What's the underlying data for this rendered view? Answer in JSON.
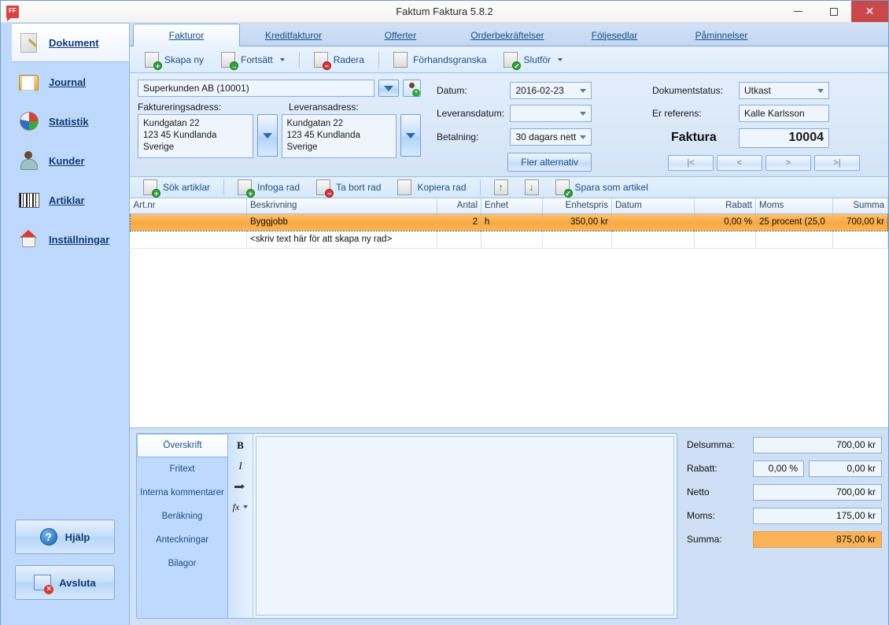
{
  "window": {
    "title": "Faktum Faktura 5.8.2",
    "app_icon": "FF",
    "minimize_label": "Minimera",
    "maximize_label": "Maximera",
    "close_label": "Stäng"
  },
  "sidebar": {
    "items": [
      {
        "label": "Dokument",
        "icon": "document-icon",
        "selected": true
      },
      {
        "label": "Journal",
        "icon": "folder-icon",
        "selected": false
      },
      {
        "label": "Statistik",
        "icon": "pie-chart-icon",
        "selected": false
      },
      {
        "label": "Kunder",
        "icon": "user-icon",
        "selected": false
      },
      {
        "label": "Artiklar",
        "icon": "barcode-icon",
        "selected": false
      },
      {
        "label": "Inställningar",
        "icon": "house-gear-icon",
        "selected": false
      }
    ],
    "buttons": [
      {
        "label": "Hjälp",
        "icon": "help-icon"
      },
      {
        "label": "Avsluta",
        "icon": "exit-icon"
      }
    ]
  },
  "tabs": [
    {
      "label": "Fakturor",
      "accel": "F",
      "active": true
    },
    {
      "label": "Kreditfakturor",
      "accel": "K",
      "active": false
    },
    {
      "label": "Offerter",
      "accel": "O",
      "active": false
    },
    {
      "label": "Orderbekräftelser",
      "accel": "O",
      "active": false
    },
    {
      "label": "Följesedlar",
      "accel": "F",
      "active": false
    },
    {
      "label": "Påminnelser",
      "accel": "P",
      "active": false
    }
  ],
  "toolbar": [
    {
      "label": "Skapa ny",
      "icon": "new-document-icon",
      "dropdown": false
    },
    {
      "label": "Fortsätt",
      "icon": "continue-document-icon",
      "dropdown": true
    },
    {
      "label": "Radera",
      "icon": "delete-document-icon",
      "dropdown": false
    },
    {
      "label": "Förhandsgranska",
      "icon": "preview-document-icon",
      "dropdown": false
    },
    {
      "label": "Slutför",
      "icon": "finish-document-icon",
      "dropdown": true
    }
  ],
  "form": {
    "customer": "Superkunden AB (10001)",
    "customer_dropdown_icon": "chevron-down-icon",
    "add_customer_icon": "add-user-icon",
    "billing_address_label": "Faktureringsadress:",
    "billing_address": "Kundgatan 22\n123 45 Kundlanda\nSverige",
    "delivery_address_label": "Leveransadress:",
    "delivery_address": "Kundgatan 22\n123 45 Kundlanda\nSverige",
    "date_label": "Datum:",
    "date_value": "2016-02-23",
    "delivery_date_label": "Leveransdatum:",
    "delivery_date_value": "",
    "payment_label": "Betalning:",
    "payment_value": "30 dagars nett",
    "more_options_label": "Fler alternativ",
    "doc_status_label": "Dokumentstatus:",
    "doc_status_value": "Utkast",
    "your_reference_label": "Er referens:",
    "your_reference_value": "Kalle Karlsson",
    "doc_type_label": "Faktura",
    "doc_number": "10004",
    "nav_buttons": [
      "|<",
      "<",
      ">",
      ">|"
    ]
  },
  "gridbar": [
    {
      "label": "Sök artiklar",
      "icon": "search-article-icon"
    },
    {
      "label": "Infoga rad",
      "icon": "insert-row-icon"
    },
    {
      "label": "Ta bort rad",
      "icon": "delete-row-icon"
    },
    {
      "label": "Kopiera rad",
      "icon": "copy-row-icon"
    },
    {
      "label": "",
      "icon": "move-up-icon"
    },
    {
      "label": "",
      "icon": "move-down-icon"
    },
    {
      "label": "Spara som artikel",
      "icon": "save-as-article-icon"
    }
  ],
  "grid": {
    "columns": [
      "Art.nr",
      "Beskrivning",
      "Antal",
      "Enhet",
      "Enhetspris",
      "Datum",
      "Rabatt",
      "Moms",
      "Summa"
    ],
    "rows": [
      {
        "artnr": "",
        "beskrivning": "Byggjobb",
        "antal": "2",
        "enhet": "h",
        "enhetspris": "350,00 kr",
        "datum": "",
        "rabatt": "0,00 %",
        "moms": "25 procent (25,0",
        "summa": "700,00 kr",
        "selected": true
      }
    ],
    "new_row_placeholder": "<skriv text här för att skapa ny rad>"
  },
  "bottom": {
    "side_tabs": [
      {
        "label": "Överskrift",
        "active": true
      },
      {
        "label": "Fritext",
        "active": false
      },
      {
        "label": "Interna kommentarer",
        "active": false
      },
      {
        "label": "Beräkning",
        "active": false
      },
      {
        "label": "Anteckningar",
        "active": false
      },
      {
        "label": "Bilagor",
        "active": false
      }
    ],
    "format_buttons": [
      {
        "label": "B",
        "icon": "bold-icon"
      },
      {
        "label": "I",
        "icon": "italic-icon"
      },
      {
        "label": "",
        "icon": "indent-icon"
      },
      {
        "label": "fx",
        "icon": "function-icon"
      }
    ],
    "editor_text": ""
  },
  "totals": [
    {
      "label": "Delsumma:",
      "value": "700,00 kr",
      "second": null,
      "highlight": false
    },
    {
      "label": "Rabatt:",
      "value": "0,00 kr",
      "second": "0,00 %",
      "highlight": false
    },
    {
      "label": "Netto",
      "value": "700,00 kr",
      "second": null,
      "highlight": false
    },
    {
      "label": "Moms:",
      "value": "175,00 kr",
      "second": null,
      "highlight": false
    },
    {
      "label": "Summa:",
      "value": "875,00 kr",
      "second": null,
      "highlight": true
    }
  ],
  "colors": {
    "sidebar_bg": "#bfd9fd",
    "panel_bg": "#cfe0f5",
    "accent_link": "#1b4f86",
    "selection_orange": "#fba93f",
    "close_red": "#c9494b"
  }
}
